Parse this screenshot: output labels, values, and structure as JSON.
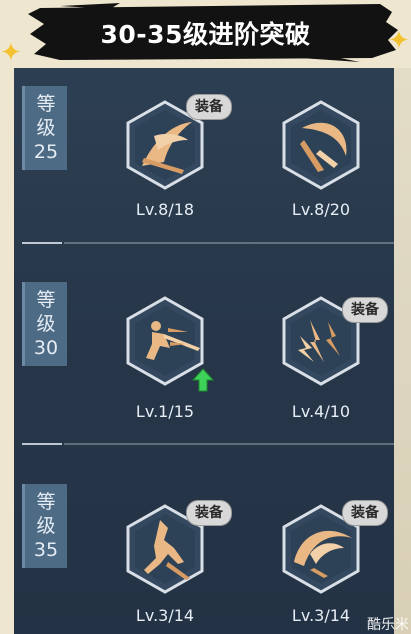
{
  "header": {
    "title": "30-35级进阶突破"
  },
  "tiers": [
    {
      "label_chars": [
        "等",
        "级",
        "25"
      ],
      "skills": [
        {
          "icon": "sword-slash-icon",
          "level": "Lv.8/18",
          "badge": "装备"
        },
        {
          "icon": "crescent-blade-icon",
          "level": "Lv.8/20",
          "badge": ""
        }
      ]
    },
    {
      "label_chars": [
        "等",
        "级",
        "30"
      ],
      "skills": [
        {
          "icon": "dash-strike-icon",
          "level": "Lv.1/15",
          "badge": "",
          "upgrade": true
        },
        {
          "icon": "lightning-burst-icon",
          "level": "Lv.4/10",
          "badge": "装备"
        }
      ]
    },
    {
      "label_chars": [
        "等",
        "级",
        "35"
      ],
      "skills": [
        {
          "icon": "leaping-kick-icon",
          "level": "Lv.3/14",
          "badge": "装备"
        },
        {
          "icon": "sweeping-arc-icon",
          "level": "Lv.3/14",
          "badge": "装备"
        }
      ]
    }
  ],
  "watermark": "酷乐米",
  "colors": {
    "panel": "#2d3f52",
    "level_box": "#4e6b86",
    "icon_gold": "#e9b884",
    "upgrade_green": "#3fd25a"
  }
}
